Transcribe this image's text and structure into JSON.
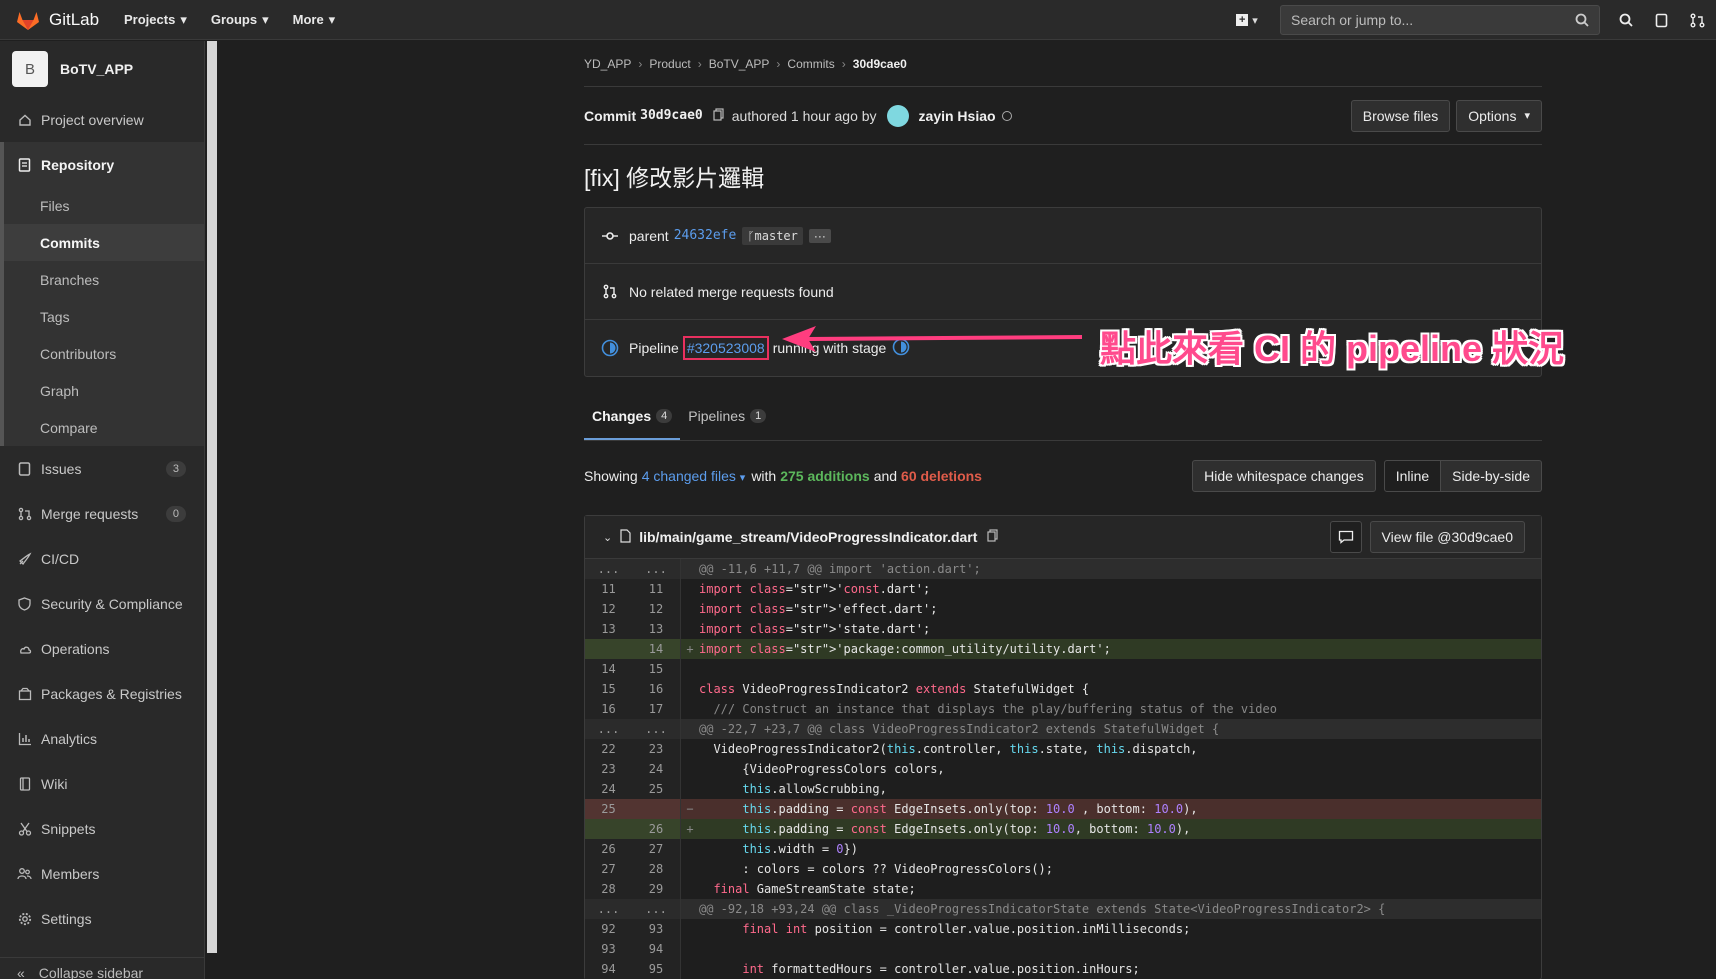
{
  "topbar": {
    "brand": "GitLab",
    "nav": [
      "Projects",
      "Groups",
      "More"
    ],
    "search_placeholder": "Search or jump to..."
  },
  "sidebar": {
    "project_initial": "B",
    "project_name": "BoTV_APP",
    "overview": "Project overview",
    "repository": "Repository",
    "repo_items": [
      "Files",
      "Commits",
      "Branches",
      "Tags",
      "Contributors",
      "Graph",
      "Compare"
    ],
    "items": [
      {
        "label": "Issues",
        "count": "3"
      },
      {
        "label": "Merge requests",
        "count": "0"
      },
      {
        "label": "CI/CD"
      },
      {
        "label": "Security & Compliance"
      },
      {
        "label": "Operations"
      },
      {
        "label": "Packages & Registries"
      },
      {
        "label": "Analytics"
      },
      {
        "label": "Wiki"
      },
      {
        "label": "Snippets"
      },
      {
        "label": "Members"
      },
      {
        "label": "Settings"
      }
    ],
    "collapse": "Collapse sidebar"
  },
  "breadcrumb": [
    "YD_APP",
    "Product",
    "BoTV_APP",
    "Commits",
    "30d9cae0"
  ],
  "commit": {
    "label": "Commit",
    "sha": "30d9cae0",
    "authored": "authored 1 hour ago by",
    "author": "zayin Hsiao",
    "browse_files": "Browse files",
    "options": "Options",
    "title": "[fix] 修改影片邏輯",
    "parent_label": "parent",
    "parent_sha": "24632efe",
    "branch": "master",
    "no_mr": "No related merge requests found",
    "pipeline_label": "Pipeline",
    "pipeline_id": "#320523008",
    "pipeline_suffix": "running with stage"
  },
  "tabs": [
    {
      "label": "Changes",
      "count": "4"
    },
    {
      "label": "Pipelines",
      "count": "1"
    }
  ],
  "diffbar": {
    "showing": "Showing",
    "changed": "4 changed files",
    "with": "with",
    "additions": "275 additions",
    "and": "and",
    "deletions": "60 deletions",
    "hide_ws": "Hide whitespace changes",
    "inline": "Inline",
    "side": "Side-by-side"
  },
  "file": {
    "path": "lib/main/game_stream/VideoProgressIndicator.dart",
    "view_file": "View file @30d9cae0"
  },
  "annotation": "點此來看 CI 的 pipeline 狀況",
  "diff_rows": [
    {
      "type": "hunk",
      "old": "...",
      "new": "...",
      "code": "@@ -11,6 +11,7 @@ import 'action.dart';"
    },
    {
      "type": "ctx",
      "old": "11",
      "new": "11",
      "code": "import 'const.dart';"
    },
    {
      "type": "ctx",
      "old": "12",
      "new": "12",
      "code": "import 'effect.dart';"
    },
    {
      "type": "ctx",
      "old": "13",
      "new": "13",
      "code": "import 'state.dart';"
    },
    {
      "type": "add",
      "old": "",
      "new": "14",
      "code": "import 'package:common_utility/utility.dart';"
    },
    {
      "type": "ctx",
      "old": "14",
      "new": "15",
      "code": ""
    },
    {
      "type": "ctx",
      "old": "15",
      "new": "16",
      "code": "class VideoProgressIndicator2 extends StatefulWidget {"
    },
    {
      "type": "ctx",
      "old": "16",
      "new": "17",
      "code": "  /// Construct an instance that displays the play/buffering status of the video"
    },
    {
      "type": "hunk",
      "old": "...",
      "new": "...",
      "code": "@@ -22,7 +23,7 @@ class VideoProgressIndicator2 extends StatefulWidget {"
    },
    {
      "type": "ctx",
      "old": "22",
      "new": "23",
      "code": "  VideoProgressIndicator2(this.controller, this.state, this.dispatch,"
    },
    {
      "type": "ctx",
      "old": "23",
      "new": "24",
      "code": "      {VideoProgressColors colors,"
    },
    {
      "type": "ctx",
      "old": "24",
      "new": "25",
      "code": "      this.allowScrubbing,"
    },
    {
      "type": "del",
      "old": "25",
      "new": "",
      "code": "      this.padding = const EdgeInsets.only(top: 10.0 , bottom: 10.0),"
    },
    {
      "type": "add",
      "old": "",
      "new": "26",
      "code": "      this.padding = const EdgeInsets.only(top: 10.0, bottom: 10.0),"
    },
    {
      "type": "ctx",
      "old": "26",
      "new": "27",
      "code": "      this.width = 0})"
    },
    {
      "type": "ctx",
      "old": "27",
      "new": "28",
      "code": "      : colors = colors ?? VideoProgressColors();"
    },
    {
      "type": "ctx",
      "old": "28",
      "new": "29",
      "code": "  final GameStreamState state;"
    },
    {
      "type": "hunk",
      "old": "...",
      "new": "...",
      "code": "@@ -92,18 +93,24 @@ class _VideoProgressIndicatorState extends State<VideoProgressIndicator2> {"
    },
    {
      "type": "ctx",
      "old": "92",
      "new": "93",
      "code": "      final int position = controller.value.position.inMilliseconds;"
    },
    {
      "type": "ctx",
      "old": "93",
      "new": "94",
      "code": ""
    },
    {
      "type": "ctx",
      "old": "94",
      "new": "95",
      "code": "      int formattedHours = controller.value.position.inHours;"
    }
  ],
  "colors": {
    "accent_link": "#5c9ded",
    "additions": "#5cb85c",
    "deletions": "#e05c4a",
    "annotation": "#ff4a8d"
  }
}
